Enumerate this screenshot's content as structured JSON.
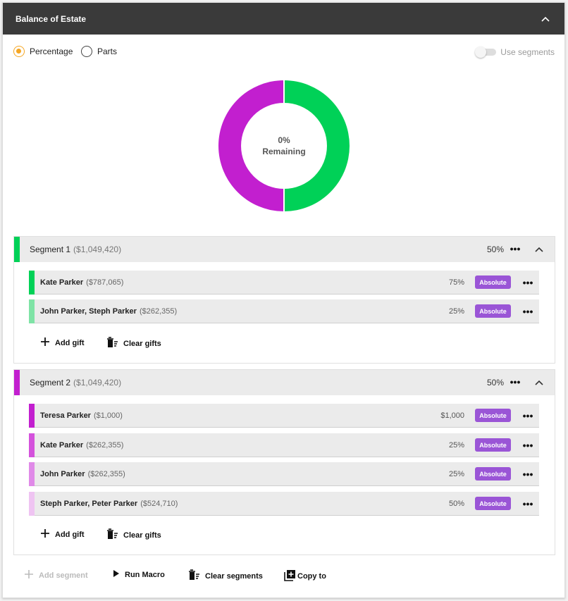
{
  "header": {
    "title": "Balance of Estate"
  },
  "options": {
    "percentage_label": "Percentage",
    "parts_label": "Parts",
    "use_segments_label": "Use segments"
  },
  "donut": {
    "center_pct": "0%",
    "center_label": "Remaining",
    "colors": [
      "#00d157",
      "#c21fcf"
    ],
    "fractions": [
      0.5,
      0.5
    ]
  },
  "segments": [
    {
      "name": "Segment 1",
      "amount": "($1,049,420)",
      "pct": "50%",
      "color": "#00d157",
      "gifts": [
        {
          "name": "Kate Parker",
          "amount": "($787,065)",
          "value": "75%",
          "badge": "Absolute",
          "color": "#00d157"
        },
        {
          "name": "John Parker, Steph Parker",
          "amount": "($262,355)",
          "value": "25%",
          "badge": "Absolute",
          "color": "#7fe3a6"
        }
      ],
      "add_gift_label": "Add gift",
      "clear_gifts_label": "Clear gifts"
    },
    {
      "name": "Segment 2",
      "amount": "($1,049,420)",
      "pct": "50%",
      "color": "#c21fcf",
      "gifts": [
        {
          "name": "Teresa Parker",
          "amount": "($1,000)",
          "value": "$1,000",
          "badge": "Absolute",
          "color": "#c21fcf"
        },
        {
          "name": "Kate Parker",
          "amount": "($262,355)",
          "value": "25%",
          "badge": "Absolute",
          "color": "#d452dc"
        },
        {
          "name": "John Parker",
          "amount": "($262,355)",
          "value": "25%",
          "badge": "Absolute",
          "color": "#e08ae8"
        },
        {
          "name": "Steph Parker, Peter Parker",
          "amount": "($524,710)",
          "value": "50%",
          "badge": "Absolute",
          "color": "#efc4f2"
        }
      ],
      "add_gift_label": "Add gift",
      "clear_gifts_label": "Clear gifts"
    }
  ],
  "footer": {
    "add_segment_label": "Add segment",
    "run_macro_label": "Run Macro",
    "clear_segments_label": "Clear segments",
    "copy_to_label": "Copy to"
  }
}
